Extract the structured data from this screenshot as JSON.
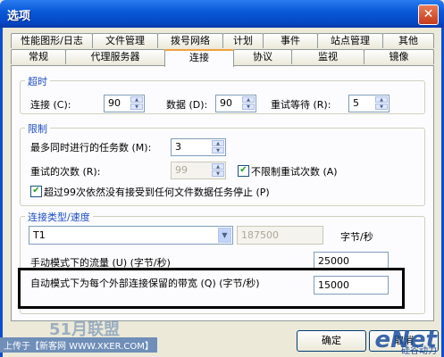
{
  "window": {
    "title": "选项",
    "close_icon": "close-icon"
  },
  "tabs_row1": [
    "性能图形/日志",
    "文件管理",
    "拨号网络",
    "计划",
    "事件",
    "站点管理",
    "其他"
  ],
  "tabs_row2": [
    "常规",
    "代理服务器",
    "连接",
    "协议",
    "监视",
    "镜像"
  ],
  "active_tab": "连接",
  "timeout": {
    "legend": "超时",
    "connect_label": "连接 (C):",
    "connect_value": "90",
    "data_label": "数据 (D):",
    "data_value": "90",
    "retry_wait_label": "重试等待 (R):",
    "retry_wait_value": "5"
  },
  "limits": {
    "legend": "限制",
    "max_tasks_label": "最多同时进行的任务数 (M):",
    "max_tasks_value": "3",
    "retry_count_label": "重试的次数 (R):",
    "retry_count_value": "99",
    "unlimited_retry_label": "不限制重试次数 (A)",
    "unlimited_retry_checked": true,
    "stop_if_no_data_label": "超过99次依然没有接受到任何文件数据任务停止 (P)",
    "stop_if_no_data_checked": true
  },
  "connection": {
    "legend": "连接类型/速度",
    "type_value": "T1",
    "speed_value": "187500",
    "speed_unit": "字节/秒",
    "manual_flow_label": "手动模式下的流量 (U) (字节/秒)",
    "manual_flow_value": "25000",
    "auto_reserved_label": "自动模式下为每个外部连接保留的带宽 (Q) (字节/秒)",
    "auto_reserved_value": "15000"
  },
  "footer": {
    "ok": "确定",
    "cancel": "取消"
  },
  "watermarks": {
    "left": "上传于【新客网 WWW.XKER.COM】",
    "brand": "51月联盟",
    "right": "eNet",
    "right_sub": "硅谷动力"
  },
  "colors": {
    "title_bar": "#0a5ad8",
    "group_legend": "#1d4ec0",
    "highlight": "#000000"
  }
}
